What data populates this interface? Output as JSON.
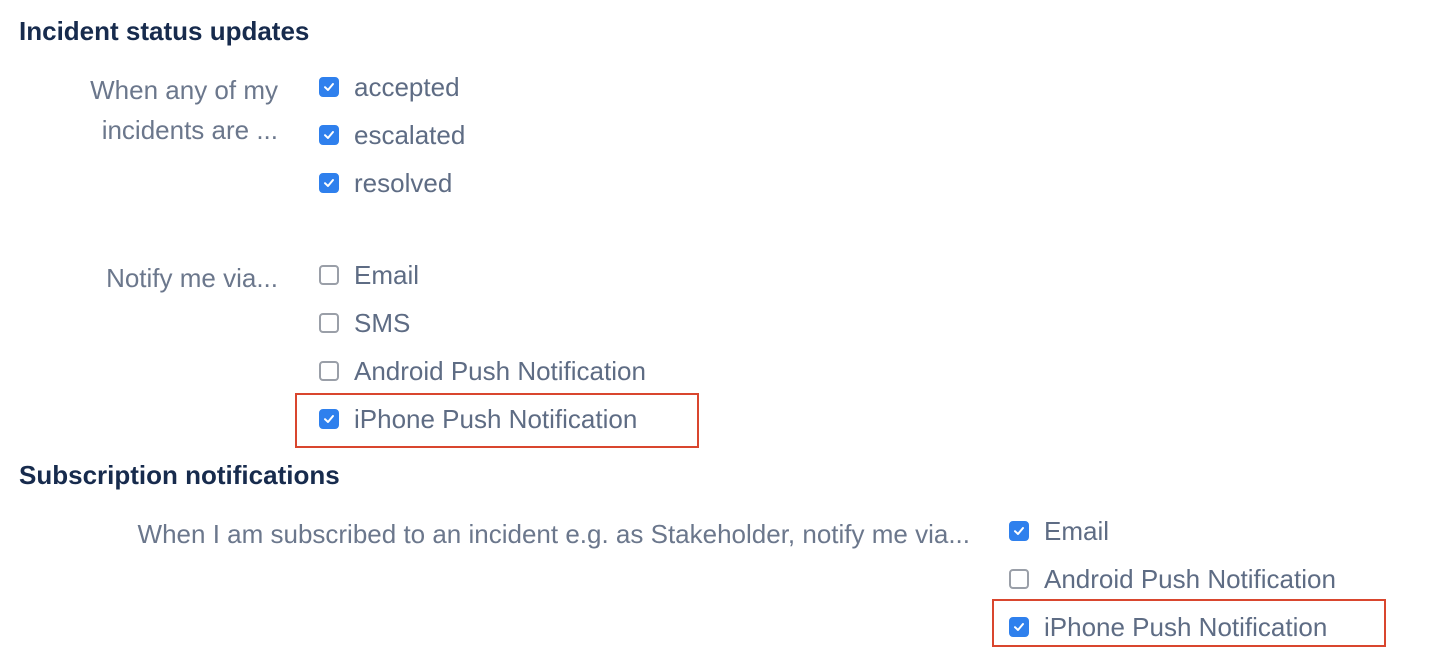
{
  "incident_status": {
    "title": "Incident status updates",
    "when_label": "When any of my incidents are ...",
    "status_options": [
      {
        "label": "accepted",
        "checked": true
      },
      {
        "label": "escalated",
        "checked": true
      },
      {
        "label": "resolved",
        "checked": true
      }
    ],
    "notify_label": "Notify me via...",
    "notify_options": [
      {
        "label": "Email",
        "checked": false
      },
      {
        "label": "SMS",
        "checked": false
      },
      {
        "label": "Android Push Notification",
        "checked": false
      },
      {
        "label": "iPhone Push Notification",
        "checked": true
      }
    ]
  },
  "subscription": {
    "title": "Subscription notifications",
    "when_label": "When I am subscribed to an incident e.g. as Stakeholder, notify me via...",
    "notify_options": [
      {
        "label": "Email",
        "checked": true
      },
      {
        "label": "Android Push Notification",
        "checked": false
      },
      {
        "label": "iPhone Push Notification",
        "checked": true
      }
    ]
  },
  "colors": {
    "accent": "#2f80ed",
    "highlight": "#d9462e",
    "heading": "#172b4d",
    "muted": "#6b778c"
  }
}
